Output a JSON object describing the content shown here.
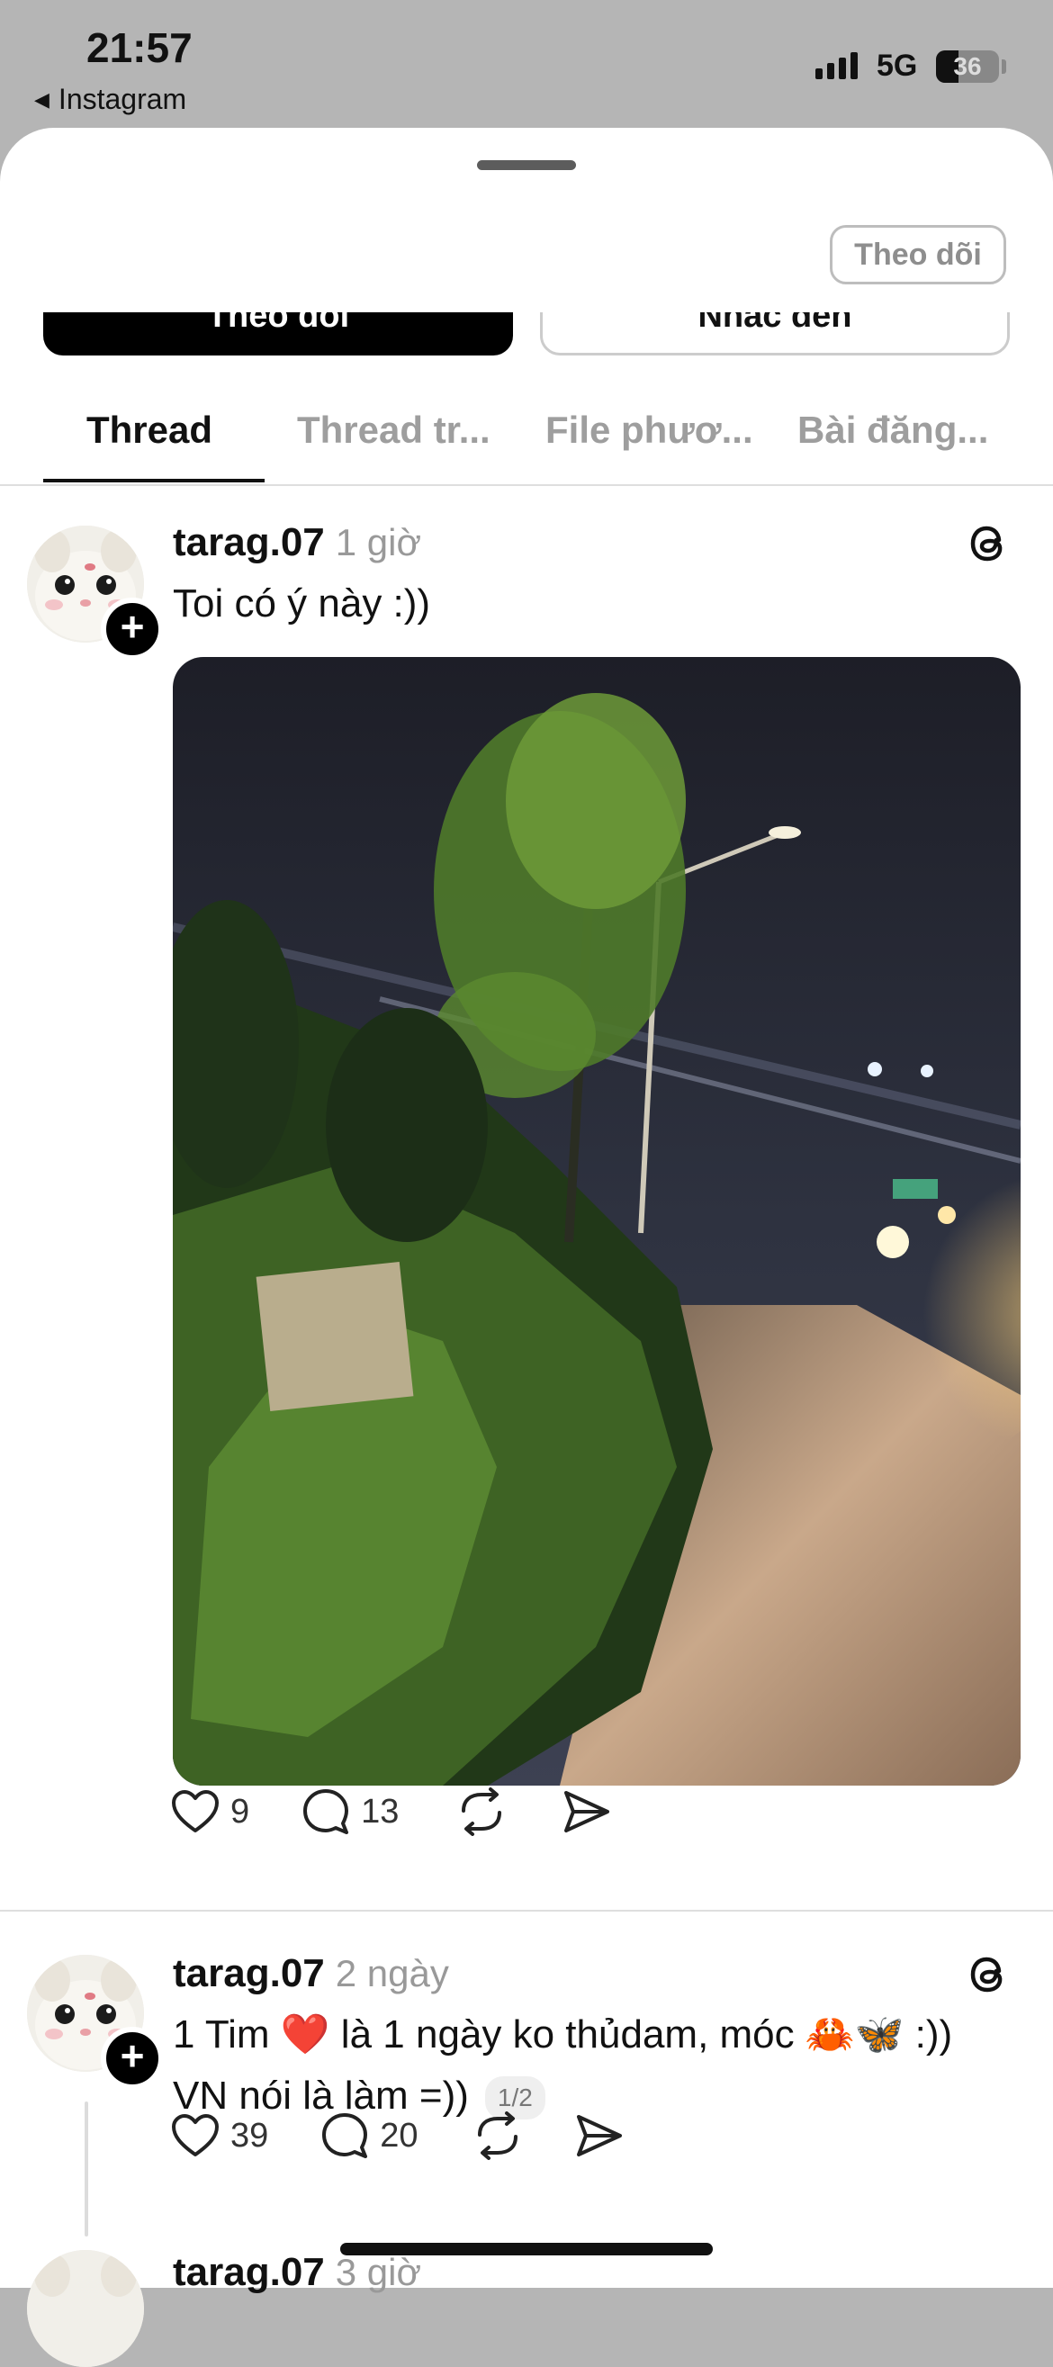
{
  "status_bar": {
    "time": "21:57",
    "back_label": "Instagram",
    "network": "5G",
    "battery": "36"
  },
  "header": {
    "follow_small": "Theo dõi",
    "follow_button": "Theo dõi",
    "mention_button": "Nhắc đến"
  },
  "tabs": [
    {
      "label": "Thread",
      "active": true
    },
    {
      "label": "Thread tr...",
      "active": false
    },
    {
      "label": "File phươ...",
      "active": false
    },
    {
      "label": "Bài đăng...",
      "active": false
    }
  ],
  "posts": [
    {
      "username": "tarag.07",
      "time_ago": "1 giờ",
      "text": "Toi có ý này :))",
      "likes": "9",
      "comments": "13"
    },
    {
      "username": "tarag.07",
      "time_ago": "2 ngày",
      "text_line1": "1 Tim ❤️ là 1 ngày ko thủdam, móc 🦀🦋 :))",
      "text_line2": "VN nói là làm =))",
      "pager": "1/2",
      "likes": "39",
      "comments": "20"
    },
    {
      "username": "tarag.07",
      "time_ago": "3 giờ"
    }
  ],
  "icons": {
    "back": "back-triangle-icon",
    "like": "heart-icon",
    "comment": "comment-bubble-icon",
    "repost": "repost-icon",
    "share": "share-send-icon",
    "threads": "threads-logo-icon",
    "follow": "plus-icon"
  }
}
